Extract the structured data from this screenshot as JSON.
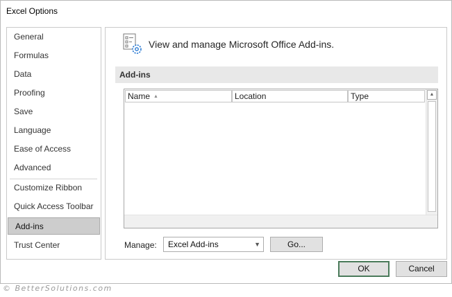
{
  "window": {
    "title": "Excel Options"
  },
  "nav": {
    "items": [
      {
        "label": "General"
      },
      {
        "label": "Formulas"
      },
      {
        "label": "Data"
      },
      {
        "label": "Proofing"
      },
      {
        "label": "Save"
      },
      {
        "label": "Language"
      },
      {
        "label": "Ease of Access"
      },
      {
        "label": "Advanced"
      },
      {
        "label": "Customize Ribbon"
      },
      {
        "label": "Quick Access Toolbar"
      },
      {
        "label": "Add-ins",
        "selected": true
      },
      {
        "label": "Trust Center"
      }
    ]
  },
  "main": {
    "heading_icon": "addins-gear-icon",
    "heading": "View and manage Microsoft Office Add-ins.",
    "section_title": "Add-ins",
    "table": {
      "columns": [
        {
          "label": "Name",
          "sorted": "ascending"
        },
        {
          "label": "Location"
        },
        {
          "label": "Type"
        }
      ],
      "rows": []
    },
    "manage": {
      "label": "Manage:",
      "selected_value": "Excel Add-ins",
      "go_label": "Go..."
    }
  },
  "footer": {
    "ok_label": "OK",
    "cancel_label": "Cancel"
  },
  "watermark": "© BetterSolutions.com",
  "colors": {
    "selected_nav_bg": "#cdcdcd",
    "section_bar_bg": "#e8e8e8",
    "ok_border": "#4a7a5a",
    "icon_blue": "#2b7bd3"
  }
}
